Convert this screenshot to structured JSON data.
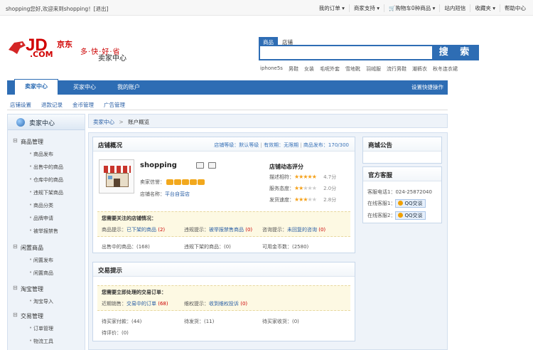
{
  "topbar": {
    "greeting": "shopping您好,欢迎来到shopping！[退出]",
    "links": [
      "我的订单 ▾",
      "商家支持 ▾",
      "购物车0种商品 ▾",
      "站内短信",
      "收藏夹 ▾",
      "帮助中心"
    ]
  },
  "header": {
    "logo_jd": "JD",
    "logo_cn": "京东",
    "logo_com": ".COM",
    "slogan": "多·快·好·省",
    "subtitle": "卖家中心",
    "search_tabs": [
      "商品",
      "店铺"
    ],
    "search_button": "搜 索",
    "hot_words": [
      "iphone5s",
      "男鞋",
      "女装",
      "毛呢外套",
      "雪地靴",
      "羽绒服",
      "流行男鞋",
      "潮裤衣",
      "秋冬连衣裙"
    ]
  },
  "nav": {
    "tabs": [
      "卖家中心",
      "买家中心",
      "我的账户"
    ],
    "quick": "设置快捷操作",
    "sub": [
      "店铺设置",
      "退款记录",
      "金币管理",
      "广告管理"
    ]
  },
  "sidebar": {
    "title": "卖家中心",
    "groups": [
      {
        "label": "商品管理",
        "items": [
          "商品发布",
          "出售中的商品",
          "仓库中的商品",
          "违规下架商品",
          "商品分类",
          "品牌申请",
          "被举报禁售"
        ]
      },
      {
        "label": "闲置商品",
        "items": [
          "闲置发布",
          "闲置商品"
        ]
      },
      {
        "label": "淘宝管理",
        "items": [
          "淘宝导入"
        ]
      },
      {
        "label": "交易管理",
        "items": [
          "订单管理",
          "物流工具"
        ]
      }
    ]
  },
  "breadcrumb": {
    "home": "卖家中心",
    "sep": ">",
    "current": "账户概览"
  },
  "overview": {
    "title": "店铺概况",
    "meta_level": "店铺等级：默认等级",
    "meta_validity": "有效期：无限期",
    "meta_goods": "商品发布：170/300",
    "shop_name": "shopping",
    "credit_label": "卖家信誉：",
    "shop_type_label": "店铺名称：",
    "shop_type": "平台自营店",
    "rating_title": "店铺动态评分",
    "ratings": [
      {
        "label": "描述相符：",
        "score": "4.7分",
        "stars": 5
      },
      {
        "label": "服务态度：",
        "score": "2.0分",
        "stars": 2
      },
      {
        "label": "发货速度：",
        "score": "2.8分",
        "stars": 3
      }
    ],
    "notice_title": "您需要关注的店铺情况：",
    "notice_items": [
      {
        "label": "商品提示：",
        "link": "已下架的商品",
        "count": "(2)"
      },
      {
        "label": "违规提示：",
        "link": "被举报禁售商品",
        "count": "(0)"
      },
      {
        "label": "咨询提示：",
        "link": "未回复的咨询",
        "count": "(0)"
      }
    ],
    "stats": [
      "出售中的商品：(168)",
      "违规下架的商品：(0)",
      "可用金币数：(2580)"
    ]
  },
  "trade": {
    "title": "交易提示",
    "notice_title": "您需要立即处理的交易订单：",
    "notice_items": [
      {
        "label": "近期销售：",
        "link": "交易中的订单",
        "count": "(68)"
      },
      {
        "label": "维权提示：",
        "link": "收到维权投诉",
        "count": "(0)"
      }
    ],
    "stats": [
      "待买家付款：(44)",
      "待发货：(11)",
      "待买家收货：(0)"
    ],
    "stat_last": "待评价：(0)"
  },
  "announce": {
    "title": "商城公告"
  },
  "service": {
    "title": "官方客服",
    "phone": "客服电话1：024-25872040",
    "qq1_label": "在线客服1：",
    "qq2_label": "在线客服2：",
    "qq_button": "QQ交谈"
  },
  "colors": {
    "brand_blue": "#2e6db4",
    "jd_red": "#d10000",
    "notice_bg": "#fdf9e3"
  }
}
